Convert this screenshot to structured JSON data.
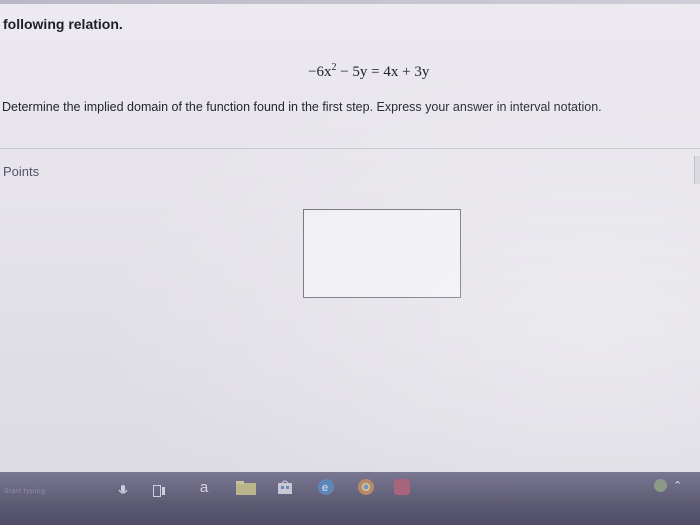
{
  "question": {
    "heading": "following relation.",
    "equation_left": "−6x",
    "equation_exp": "2",
    "equation_right": " − 5y = 4x + 3y",
    "instruction": "Determine the implied domain of the function found in the first step. Express your answer in interval notation."
  },
  "answer": {
    "label": "Points",
    "value": ""
  },
  "taskbar": {
    "search_hint": "Start typing",
    "icons": [
      "windows-icon",
      "task-view-icon",
      "amazon-icon",
      "file-explorer-icon",
      "store-icon",
      "edge-icon",
      "chrome-icon",
      "app-icon"
    ]
  }
}
